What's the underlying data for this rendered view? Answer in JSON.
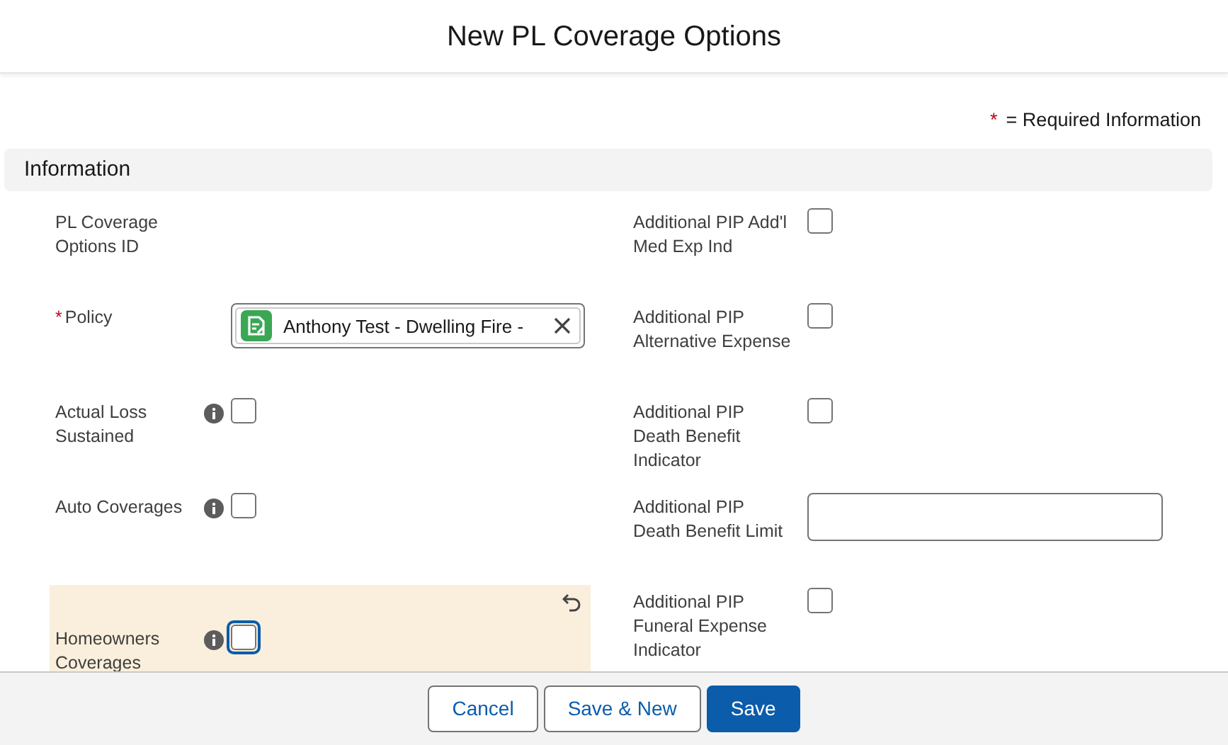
{
  "modal": {
    "title": "New PL Coverage Options"
  },
  "required_note": {
    "mark": "*",
    "text": "= Required Information"
  },
  "section": {
    "title": "Information"
  },
  "rows": [
    {
      "left": {
        "label": "PL Coverage Options ID",
        "kind": "readonly",
        "required": false,
        "info": false,
        "edited": false
      },
      "right": {
        "label": "Additional PIP Add'l Med Exp Ind",
        "kind": "checkbox",
        "checked": false
      }
    },
    {
      "left": {
        "label": "Policy",
        "kind": "lookup",
        "required": true,
        "info": false,
        "edited": false,
        "value": "Anthony Test - Dwelling Fire -"
      },
      "right": {
        "label": "Additional PIP Alternative Expense",
        "kind": "checkbox",
        "checked": false
      }
    },
    {
      "left": {
        "label": "Actual Loss Sustained",
        "kind": "checkbox",
        "required": false,
        "info": true,
        "edited": false,
        "checked": false,
        "focused": false
      },
      "right": {
        "label": "Additional PIP Death Benefit Indicator",
        "kind": "checkbox",
        "checked": false
      }
    },
    {
      "left": {
        "label": "Auto Coverages",
        "kind": "checkbox",
        "required": false,
        "info": true,
        "edited": false,
        "checked": false,
        "focused": false
      },
      "right": {
        "label": "Additional PIP Death Benefit Limit",
        "kind": "text"
      }
    },
    {
      "left": {
        "label": "Homeowners Coverages",
        "kind": "checkbox",
        "required": false,
        "info": true,
        "edited": true,
        "checked": false,
        "focused": true
      },
      "right": {
        "label": "Additional PIP Funeral Expense Indicator",
        "kind": "checkbox",
        "checked": false
      }
    }
  ],
  "footer": {
    "buttons": [
      {
        "label": "Cancel",
        "kind": "neutral"
      },
      {
        "label": "Save & New",
        "kind": "neutral"
      },
      {
        "label": "Save",
        "kind": "brand"
      }
    ]
  }
}
